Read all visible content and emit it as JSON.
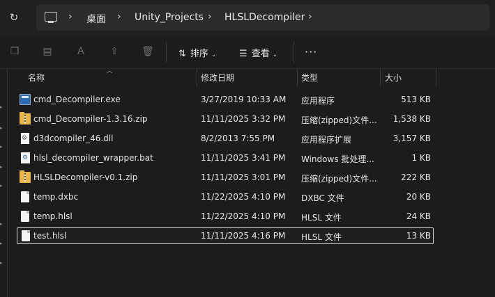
{
  "address": {
    "crumbs": [
      "桌面",
      "Unity_Projects",
      "HLSLDecompiler"
    ],
    "refresh_icon": "refresh-icon",
    "pc_icon": "computer-icon"
  },
  "toolbar": {
    "sort_label": "排序",
    "view_label": "查看",
    "more_label": "···"
  },
  "columns": {
    "name": "名称",
    "modified": "修改日期",
    "type": "类型",
    "size": "大小"
  },
  "files": [
    {
      "name": "cmd_Decompiler.exe",
      "modified": "3/27/2019 10:33 AM",
      "type": "应用程序",
      "size": "513 KB",
      "icon": "exe"
    },
    {
      "name": "cmd_Decompiler-1.3.16.zip",
      "modified": "11/11/2025 3:32 PM",
      "type": "压缩(zipped)文件...",
      "size": "1,538 KB",
      "icon": "zip"
    },
    {
      "name": "d3dcompiler_46.dll",
      "modified": "8/2/2013 7:55 PM",
      "type": "应用程序扩展",
      "size": "3,157 KB",
      "icon": "dll"
    },
    {
      "name": "hlsl_decompiler_wrapper.bat",
      "modified": "11/11/2025 3:41 PM",
      "type": "Windows 批处理...",
      "size": "1 KB",
      "icon": "bat"
    },
    {
      "name": "HLSLDecompiler-v0.1.zip",
      "modified": "11/11/2025 3:01 PM",
      "type": "压缩(zipped)文件...",
      "size": "222 KB",
      "icon": "zip"
    },
    {
      "name": "temp.dxbc",
      "modified": "11/22/2025 4:10 PM",
      "type": "DXBC 文件",
      "size": "20 KB",
      "icon": "doc"
    },
    {
      "name": "temp.hlsl",
      "modified": "11/22/2025 4:10 PM",
      "type": "HLSL 文件",
      "size": "24 KB",
      "icon": "doc"
    },
    {
      "name": "test.hlsl",
      "modified": "11/11/2025 4:16 PM",
      "type": "HLSL 文件",
      "size": "13 KB",
      "icon": "doc",
      "selected": true
    }
  ]
}
